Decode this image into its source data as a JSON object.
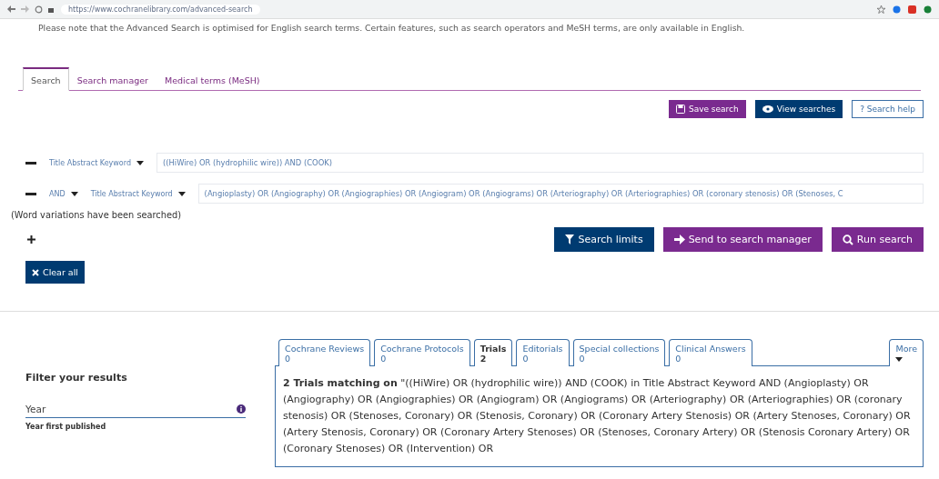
{
  "browser": {
    "url": "https://www.cochranelibrary.com/advanced-search"
  },
  "notice": "Please note that the Advanced Search is optimised for English search terms. Certain features, such as search operators and MeSH terms, are only available in English.",
  "tabs": [
    {
      "label": "Search",
      "selected": true
    },
    {
      "label": "Search manager",
      "selected": false
    },
    {
      "label": "Medical terms (MeSH)",
      "selected": false
    }
  ],
  "toolbar_buttons": [
    {
      "label": "Save search",
      "kind": "save"
    },
    {
      "label": "View searches",
      "kind": "view"
    },
    {
      "label": "? Search help",
      "kind": "help"
    }
  ],
  "search_rows": [
    {
      "field": "Title Abstract Keyword",
      "query": "((HiWire) OR (hydrophilic wire)) AND (COOK)"
    },
    {
      "operator": "AND",
      "field": "Title Abstract Keyword",
      "query": "(Angioplasty) OR (Angiography) OR (Angiographies) OR (Angiogram) OR (Angiograms) OR (Arteriography) OR (Arteriographies) OR (coronary stenosis) OR (Stenoses, C"
    }
  ],
  "word_variations_note": "(Word variations have been searched)",
  "action_buttons": [
    {
      "label": "Search limits",
      "kind": "limits"
    },
    {
      "label": "Send to search manager",
      "kind": "send"
    },
    {
      "label": "Run search",
      "kind": "run"
    }
  ],
  "clear_all": "Clear all",
  "filter": {
    "title": "Filter your results",
    "year_label": "Year",
    "year_hint": "Year first published"
  },
  "result_tabs": [
    {
      "label": "Cochrane Reviews",
      "count": "0",
      "selected": false
    },
    {
      "label": "Cochrane Protocols",
      "count": "0",
      "selected": false
    },
    {
      "label": "Trials",
      "count": "2",
      "selected": true
    },
    {
      "label": "Editorials",
      "count": "0",
      "selected": false
    },
    {
      "label": "Special collections",
      "count": "0",
      "selected": false
    },
    {
      "label": "Clinical Answers",
      "count": "0",
      "selected": false
    }
  ],
  "more_tab": "More",
  "results_summary": "**2 Trials matching on** \"((HiWire) OR (hydrophilic wire)) AND (COOK) in Title Abstract Keyword AND (Angioplasty) OR (Angiography) OR (Angiographies) OR (Angiogram) OR (Angiograms) OR (Arteriography) OR (Arteriographies) OR (coronary stenosis) OR (Stenoses, Coronary) OR (Stenosis, Coronary) OR (Coronary Artery Stenosis) OR (Artery Stenoses, Coronary) OR (Artery Stenosis, Coronary) OR (Coronary Artery Stenoses) OR (Stenoses, Coronary Artery) OR (Stenosis Coronary Artery) OR (Coronary Stenoses) OR (Intervention) OR"
}
